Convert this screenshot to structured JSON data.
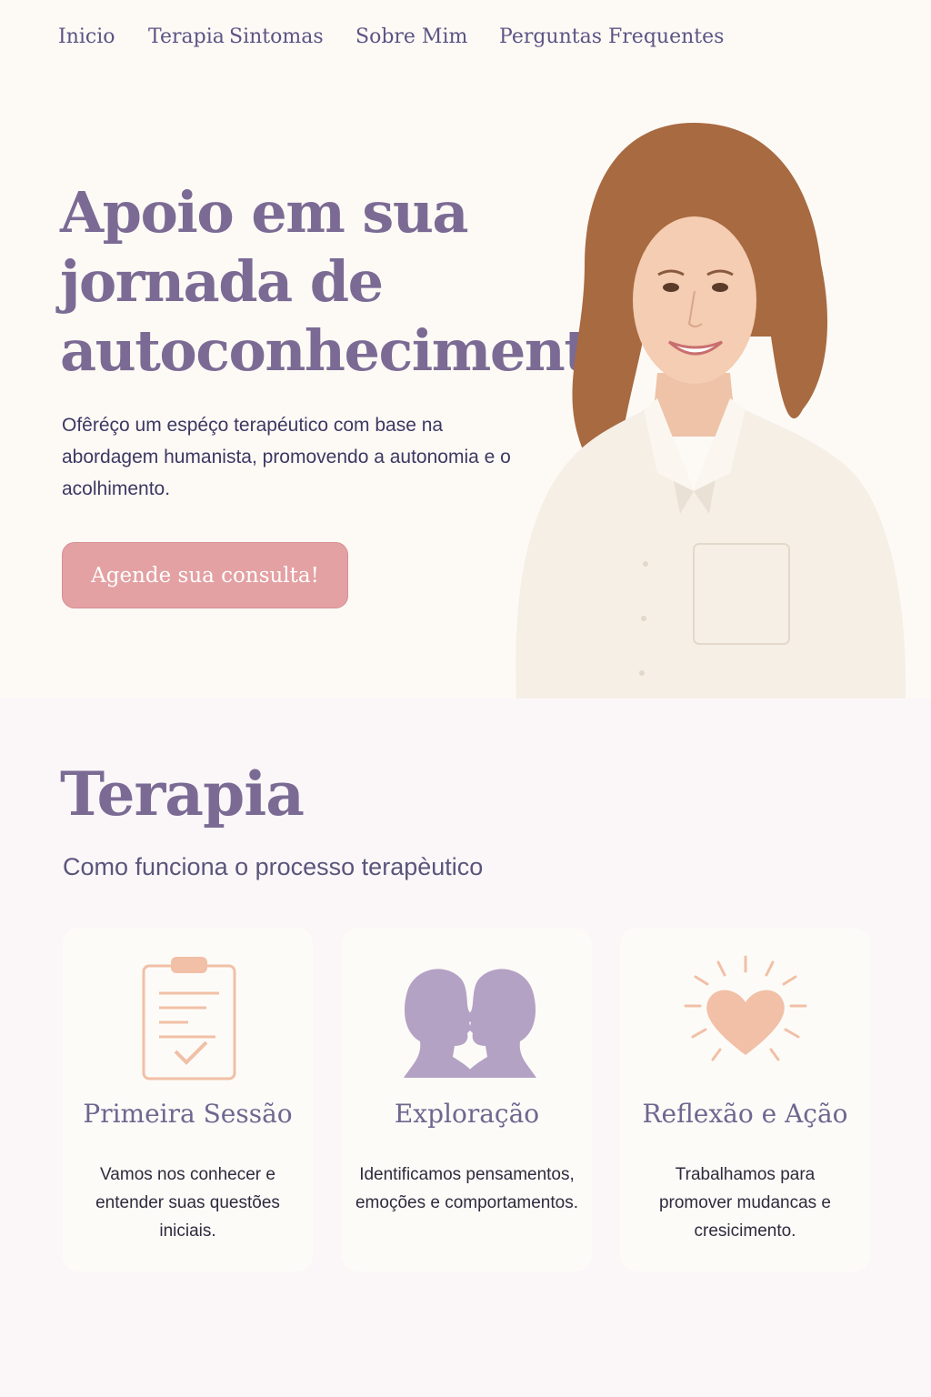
{
  "nav": {
    "items": [
      "Inicio",
      "Terapia",
      "Sintomas",
      "Sobre Mim",
      "Perguntas Frequentes"
    ]
  },
  "hero": {
    "title": "Apoio em sua jornada de autoconhecimento",
    "text": "Ofêréço um espéço terapéutico com base na abordagem humanista, promovendo a autonomia e o acolhimento.",
    "cta_label": "Agende sua consulta!"
  },
  "therapy": {
    "title": "Terapia",
    "subtitle": "Como funciona o processo terapèutico",
    "cards": [
      {
        "icon": "clipboard-check-icon",
        "title": "Primeira Sessão",
        "text": "Vamos nos conhecer e entender suas questões iniciais."
      },
      {
        "icon": "two-faces-icon",
        "title": "Exploração",
        "text": "Identificamos pensamentos, emoções e comportamentos."
      },
      {
        "icon": "radiant-heart-icon",
        "title": "Reflexão e Ação",
        "text": "Trabalhamos para promover mudancas e cresicimento."
      }
    ]
  },
  "colors": {
    "accent_purple": "#7b6b94",
    "nav_text": "#5c5484",
    "cta_pink": "#e3a1a3",
    "icon_peach": "#f1c0a6",
    "icon_lilac": "#b4a2c4"
  }
}
